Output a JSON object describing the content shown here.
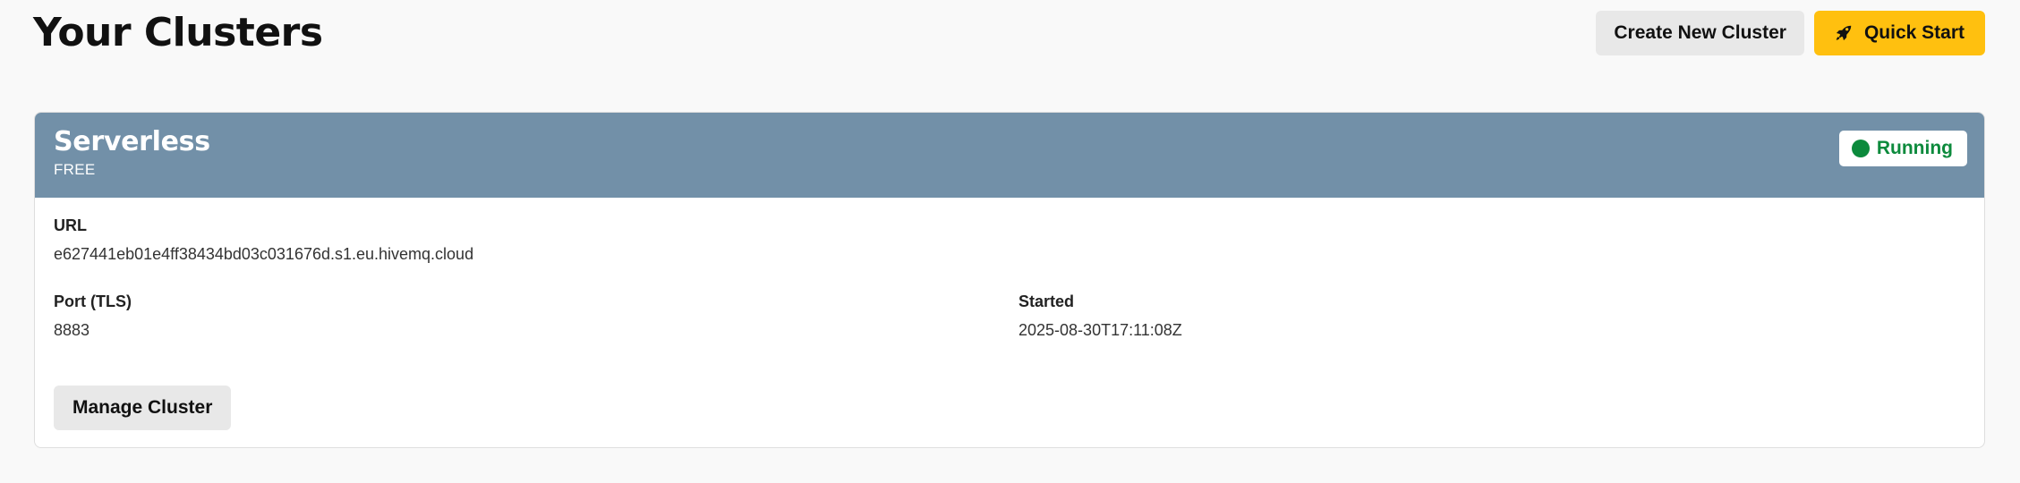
{
  "page": {
    "title": "Your Clusters"
  },
  "header_actions": {
    "create_label": "Create New Cluster",
    "quick_start_label": "Quick Start",
    "quick_start_icon": "rocket-icon"
  },
  "clusters": [
    {
      "name": "Serverless",
      "plan": "FREE",
      "status": "Running",
      "status_color": "#0c8a3c",
      "header_color": "#7290a8",
      "url_label": "URL",
      "url_value": "e627441eb01e4ff38434bd03c031676d.s1.eu.hivemq.cloud",
      "port_label": "Port (TLS)",
      "port_value": "8883",
      "started_label": "Started",
      "started_value": "2025-08-30T17:11:08Z",
      "manage_label": "Manage Cluster"
    }
  ],
  "colors": {
    "accent": "#ffc00f",
    "secondary_button": "#e8e8e8",
    "background": "#f9f9f9"
  }
}
